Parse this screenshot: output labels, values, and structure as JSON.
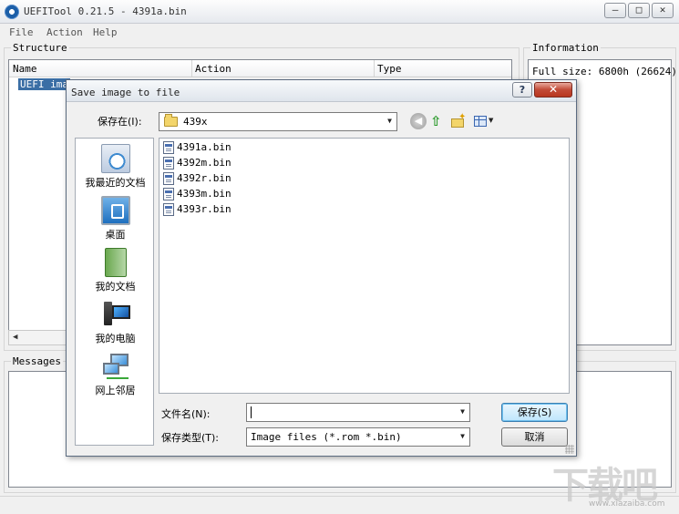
{
  "window": {
    "title": "UEFITool 0.21.5 - 4391a.bin",
    "controls": {
      "minimize": "—",
      "maximize": "□",
      "close": "✕"
    }
  },
  "menu": [
    {
      "label": "File"
    },
    {
      "label": "Action"
    },
    {
      "label": "Help"
    }
  ],
  "structure": {
    "group_label": "Structure",
    "columns": [
      "Name",
      "Action",
      "Type"
    ],
    "selected_row": "UEFI ima"
  },
  "information": {
    "group_label": "Information",
    "text": "Full size: 6800h (26624)"
  },
  "messages": {
    "group_label": "Messages"
  },
  "dialog": {
    "title": "Save image to file",
    "help_label": "?",
    "close_label": "✕",
    "save_in_label": "保存在(I):",
    "current_folder": "439x",
    "places": [
      {
        "name": "recent",
        "label": "我最近的文档",
        "icon": "recent-documents-icon"
      },
      {
        "name": "desktop",
        "label": "桌面",
        "icon": "desktop-icon"
      },
      {
        "name": "my-documents",
        "label": "我的文档",
        "icon": "my-documents-icon"
      },
      {
        "name": "my-computer",
        "label": "我的电脑",
        "icon": "my-computer-icon"
      },
      {
        "name": "network",
        "label": "网上邻居",
        "icon": "network-places-icon"
      }
    ],
    "files": [
      "4391a.bin",
      "4392m.bin",
      "4392r.bin",
      "4393m.bin",
      "4393r.bin"
    ],
    "filename_label": "文件名(N):",
    "filename_value": "",
    "filetype_label": "保存类型(T):",
    "filetype_value": "Image files (*.rom *.bin)",
    "save_button": "保存(S)",
    "cancel_button": "取消"
  },
  "watermark": {
    "big": "下载吧",
    "small": "www.xiazaiba.com"
  }
}
